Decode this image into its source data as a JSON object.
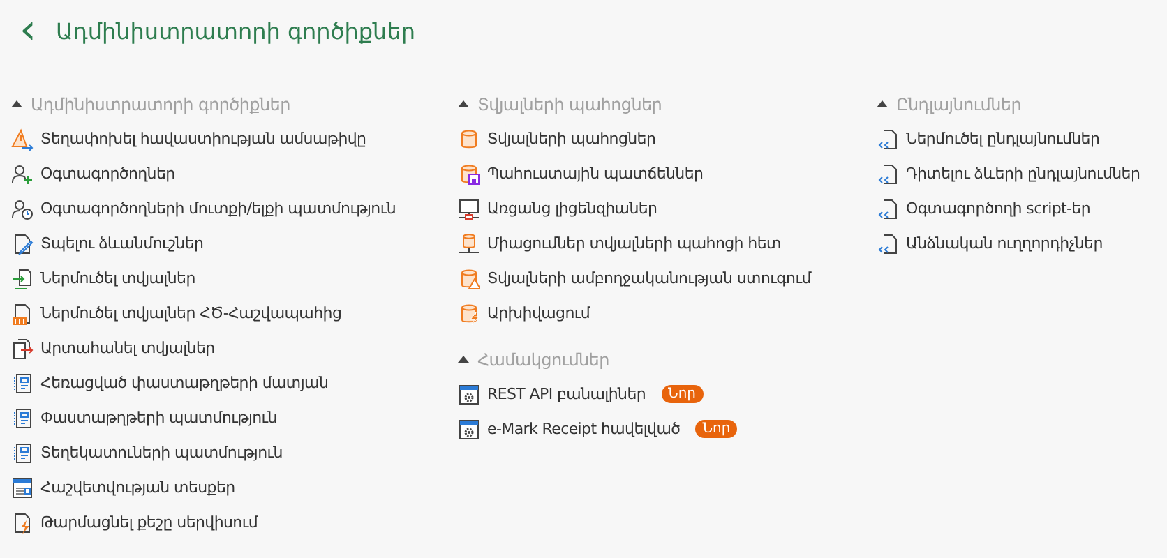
{
  "header": {
    "back": "‹",
    "title": "Ադմինիստրատորի գործիքներ"
  },
  "columns": [
    {
      "sections": [
        {
          "title": "Ադմինիստրատորի գործիքներ",
          "expanded": true,
          "items": [
            {
              "label": "Տեղափոխել հավաստիության ամսաթիվը",
              "kind": "warning-arrow"
            },
            {
              "label": "Օգտագործողներ",
              "kind": "user-add"
            },
            {
              "label": "Օգտագործողների մուտքի/ելքի պատմություն",
              "kind": "user-clock"
            },
            {
              "label": "Տպելու ձևանմուշներ",
              "kind": "doc-pen"
            },
            {
              "label": "Ներմուծել տվյալներ",
              "kind": "import"
            },
            {
              "label": "Ներմուծել տվյալներ ՀԾ-Հաշվապահից",
              "kind": "import-hc"
            },
            {
              "label": "Արտահանել տվյալներ",
              "kind": "export"
            },
            {
              "label": "Հեռացված փաստաթղթերի մատյան",
              "kind": "list"
            },
            {
              "label": "Փաստաթղթերի պատմություն",
              "kind": "list"
            },
            {
              "label": "Տեղեկատուների պատմություն",
              "kind": "list"
            },
            {
              "label": "Հաշվետվության տեսքեր",
              "kind": "window"
            },
            {
              "label": "Թարմացնել քեշը սերվիսում",
              "kind": "doc-bolt"
            }
          ]
        }
      ]
    },
    {
      "sections": [
        {
          "title": "Տվյալների պահոցներ",
          "expanded": true,
          "items": [
            {
              "label": "Տվյալների պահոցներ",
              "kind": "db"
            },
            {
              "label": "Պահուստային պատճեններ",
              "kind": "db-save"
            },
            {
              "label": "Առցանց լիցենզիաներ",
              "kind": "monitor"
            },
            {
              "label": "Միացումներ տվյալների պահոցի հետ",
              "kind": "db-network"
            },
            {
              "label": "Տվյալների ամբողջականության ստուգում",
              "kind": "db-warning"
            },
            {
              "label": "Արխիվացում",
              "kind": "db-bolt"
            }
          ]
        },
        {
          "title": "Համակցումներ",
          "expanded": true,
          "items": [
            {
              "label": "REST API բանալիներ",
              "kind": "window-gear",
              "badge": "Նոր"
            },
            {
              "label": "e-Mark Receipt հավելված",
              "kind": "window-gear",
              "badge": "Նոր"
            }
          ]
        }
      ]
    },
    {
      "sections": [
        {
          "title": "Ընդլայնումներ",
          "expanded": true,
          "items": [
            {
              "label": "Ներմուծել ընդլայնումներ",
              "kind": "code-doc"
            },
            {
              "label": "Դիտելու ձևերի ընդլայնումներ",
              "kind": "code-doc"
            },
            {
              "label": "Օգտագործողի script-եր",
              "kind": "code-doc"
            },
            {
              "label": "Անձնական ուղղորդիչներ",
              "kind": "code-doc"
            }
          ]
        }
      ]
    }
  ]
}
